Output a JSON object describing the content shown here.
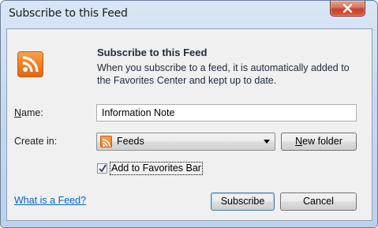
{
  "window": {
    "title": "Subscribe to this Feed",
    "close_icon": "close-icon"
  },
  "header": {
    "icon": "rss-feed-icon",
    "heading": "Subscribe to this Feed",
    "description": "When you subscribe to a feed, it is automatically added to the Favorites Center and kept up to date."
  },
  "form": {
    "name_label": "Name:",
    "name_label_ul": "N",
    "name_label_rest": "ame:",
    "name_value": "Information Note",
    "create_label": "Create in:",
    "create_selected": "Feeds",
    "create_icon": "rss-folder-icon",
    "new_folder_ul": "N",
    "new_folder_rest": "ew folder",
    "checkbox_checked": true,
    "checkbox_label": "Add to Favorites Bar"
  },
  "footer": {
    "link": "What is a Feed?",
    "subscribe": "Subscribe",
    "cancel": "Cancel"
  },
  "colors": {
    "accent": "#3c7fb1",
    "rss_orange": "#ef7d22",
    "link_blue": "#0066cc",
    "close_red": "#c6412b"
  }
}
